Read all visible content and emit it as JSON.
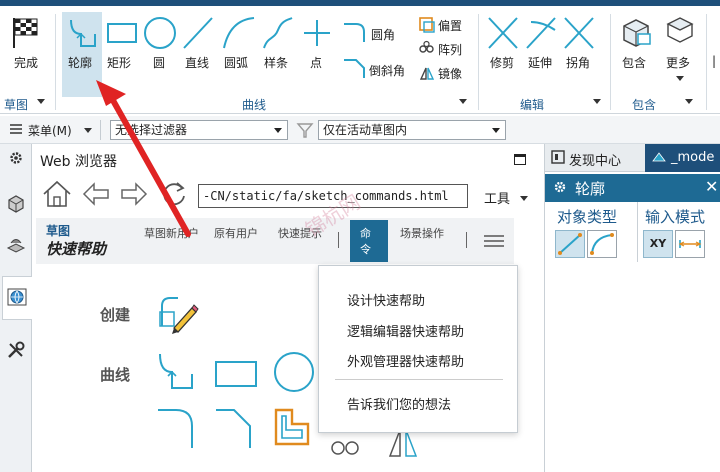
{
  "ribbon": {
    "buttons": {
      "finish": "完成",
      "contour": "轮廓",
      "rect": "矩形",
      "circle": "圆",
      "line": "直线",
      "arc": "圆弧",
      "spline": "样条",
      "point": "点",
      "fillet": "圆角",
      "chamfer": "倒斜角",
      "offset": "偏置",
      "pattern": "阵列",
      "mirror": "镜像",
      "trim": "修剪",
      "extend": "延伸",
      "corner": "拐角",
      "include": "包含",
      "more": "更多"
    },
    "groups": {
      "sketch": "草图",
      "curve": "曲线",
      "edit": "编辑",
      "include": "包含"
    }
  },
  "toolbar2": {
    "menu_label": "菜单(M)",
    "filter_value": "无选择过滤器",
    "scope_value": "仅在活动草图内"
  },
  "browser": {
    "title": "Web 浏览器",
    "url": "-CN/static/fa/sketch_commands.html",
    "tools_label": "工具",
    "nav": {
      "brand_top": "草图",
      "brand_bottom": "快速帮助",
      "tab1": "草图新用户",
      "tab2": "原有用户",
      "tab3": "快速提示",
      "tab4": "命令",
      "tab5": "场景操作"
    },
    "sections": {
      "create": "创建",
      "curve": "曲线"
    },
    "watermark": "锦杭网",
    "dropdown": {
      "items": [
        "设计快速帮助",
        "逻辑编辑器快速帮助",
        "外观管理器快速帮助",
        "告诉我们您的想法"
      ]
    }
  },
  "rightpanel": {
    "tabs": [
      "发现中心",
      "_mode"
    ],
    "header": "轮廓",
    "object_type_label": "对象类型",
    "input_mode_label": "输入模式",
    "xy_label": "XY"
  },
  "colors": {
    "accent": "#2aa3c9",
    "dark_header": "#1e4f7a",
    "arrow": "#e02424"
  }
}
